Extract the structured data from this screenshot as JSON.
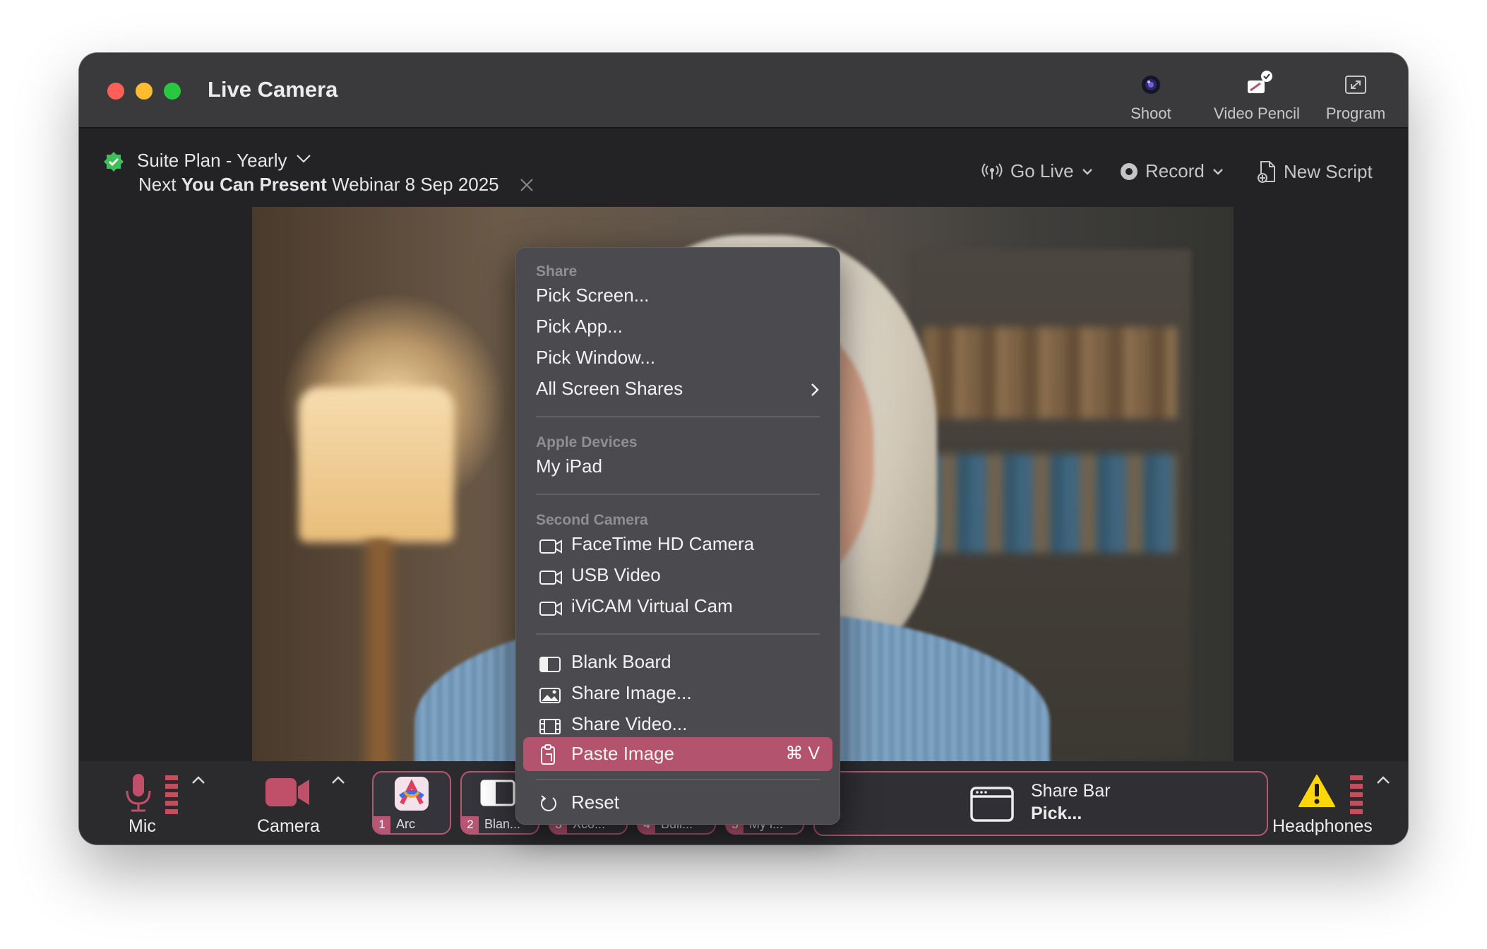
{
  "window": {
    "title": "Live Camera"
  },
  "toolbar": {
    "shoot": "Shoot",
    "video_pencil": "Video Pencil",
    "program": "Program"
  },
  "plan": {
    "name": "Suite Plan - Yearly",
    "webinar_prefix": "Next",
    "webinar_bold": "You Can Present",
    "webinar_suffix": "Webinar 8 Sep 2025"
  },
  "controls": {
    "go_live": "Go Live",
    "record": "Record",
    "new_script": "New Script"
  },
  "menu": {
    "share_header": "Share",
    "pick_screen": "Pick Screen...",
    "pick_app": "Pick App...",
    "pick_window": "Pick Window...",
    "all_screen_shares": "All Screen Shares",
    "apple_devices_header": "Apple Devices",
    "my_ipad": "My iPad",
    "second_camera_header": "Second Camera",
    "facetime_camera": "FaceTime HD Camera",
    "usb_video": "USB Video",
    "ivicam": "iViCAM Virtual Cam",
    "blank_board": "Blank Board",
    "share_image": "Share Image...",
    "share_video": "Share Video...",
    "paste_image": "Paste Image",
    "paste_shortcut": "⌘ V",
    "reset": "Reset"
  },
  "bottom": {
    "mic": "Mic",
    "camera": "Camera",
    "headphones": "Headphones",
    "tiles": [
      {
        "num": "1",
        "label": "Arc"
      },
      {
        "num": "2",
        "label": "Blan..."
      },
      {
        "num": "3",
        "label": "Xco..."
      },
      {
        "num": "4",
        "label": "Buil..."
      },
      {
        "num": "5",
        "label": "My i..."
      }
    ],
    "share_bar_title": "Share Bar",
    "share_bar_action": "Pick..."
  },
  "colors": {
    "accent": "#b4536d",
    "window_bg": "#232326",
    "menu_bg": "#4b4b4f"
  },
  "icons": [
    "shoot-lens-icon",
    "video-pencil-icon",
    "program-expand-icon",
    "verified-badge-icon",
    "broadcast-icon",
    "record-icon",
    "new-script-icon",
    "mic-icon",
    "camera-icon",
    "warning-icon",
    "window-icon"
  ]
}
